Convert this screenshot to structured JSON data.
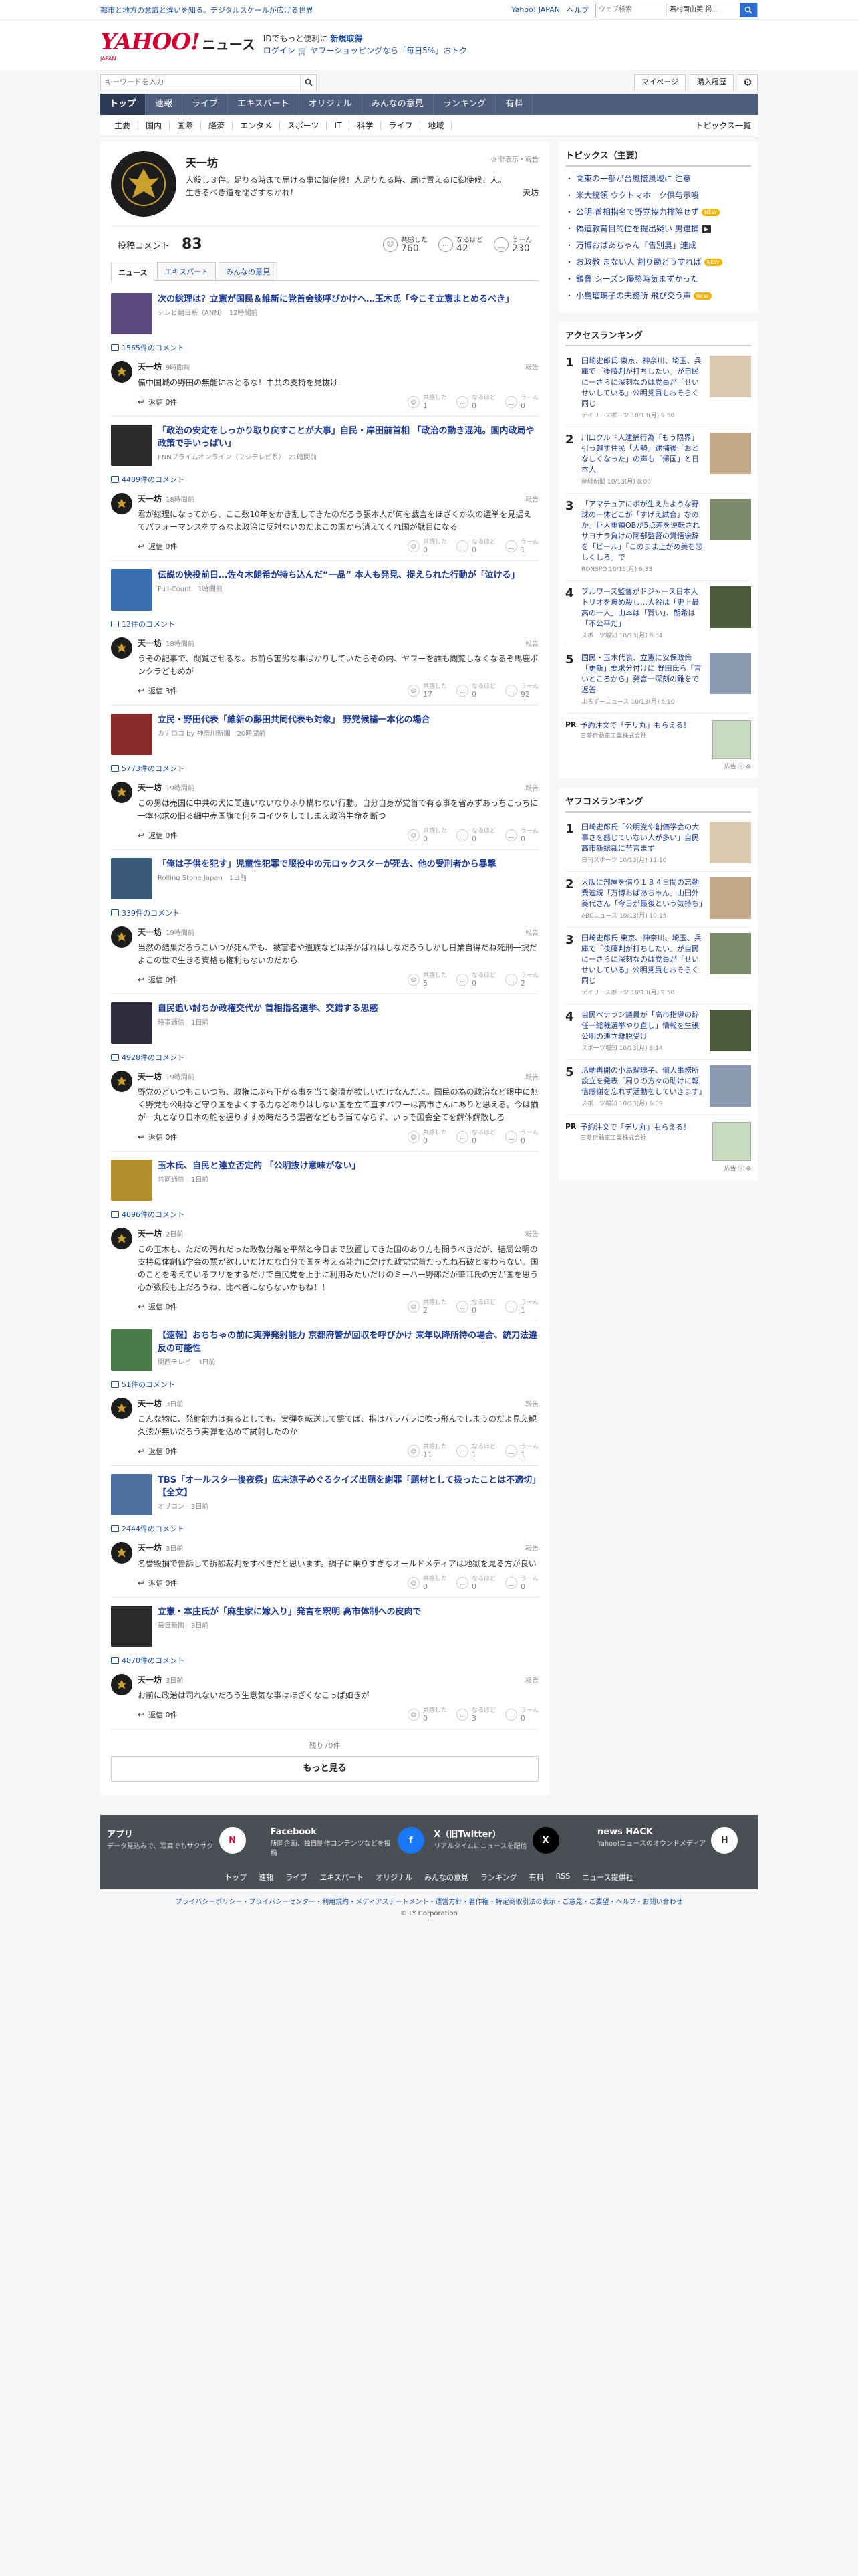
{
  "topstrip": {
    "announce": "都市と地方の意識と違いを知る。デジタルスケールが広げる世界",
    "yj": "Yahoo! JAPAN",
    "help": "ヘルプ",
    "search_placeholder": "ウェブ検索",
    "location": "若村両由美 掲...",
    "search_icon": "search-icon"
  },
  "header": {
    "logo_main": "YAHOO!",
    "logo_sub": "JAPAN",
    "logo_news": "ニュース",
    "promo_l1a": "ID",
    "promo_l1b": "でもっと便利に",
    "promo_l1c": "新規取得",
    "promo_l2a": "ログイン",
    "promo_l2b": "ヤフーショッピングなら「毎日5%」おトク"
  },
  "searchrow": {
    "placeholder": "キーワードを入力",
    "mypage": "マイページ",
    "history": "購入履歴"
  },
  "mainnav": [
    "トップ",
    "速報",
    "ライブ",
    "エキスパート",
    "オリジナル",
    "みんなの意見",
    "ランキング",
    "有料"
  ],
  "subnav": {
    "items": [
      "主要",
      "国内",
      "国際",
      "経済",
      "エンタメ",
      "スポーツ",
      "IT",
      "科学",
      "ライフ",
      "地域"
    ],
    "all": "トピックス一覧"
  },
  "profile": {
    "name": "天一坊",
    "report": "非表示・報告",
    "bio": "人殺し３件。足りる時まで届ける事に御使候！人足りたる時、届け置えるに御使候！人。生きるべき道を閉ざすなかれ！",
    "sig": "天坊",
    "count_label": "投稿コメント",
    "count": "83",
    "rx": [
      {
        "label": "共感した",
        "n": "760"
      },
      {
        "label": "なるほど",
        "n": "42"
      },
      {
        "label": "うーん",
        "n": "230"
      }
    ]
  },
  "tabs": [
    "ニュース",
    "エキスパート",
    "みんなの意見"
  ],
  "comments": [
    {
      "title": "次の総理は？立憲が国民＆維新に党首会談呼びかけへ…玉木氏「今こそ立憲まとめるべき」",
      "src": "テレビ朝日系（ANN）",
      "atime": "12時間前",
      "ccount": "1565件のコメント",
      "ctime": "9時間前",
      "text": "備中国城の野田の無能におとるな！中共の支持を見抜け",
      "replies": "返信 0件",
      "rx": [
        "1",
        "0",
        "0"
      ],
      "thumb": "#5a4b7c"
    },
    {
      "title": "「政治の安定をしっかり取り戻すことが大事」自民・岸田前首相 「政治の動き混沌。国内政局や政策で手いっぱい」",
      "src": "FNNプライムオンライン（フジテレビ系）",
      "atime": "21時間前",
      "ccount": "4489件のコメント",
      "ctime": "18時間前",
      "text": "君が総理になってから、ここ数10年をかき乱してきたのだろう張本人が何を戯言をほざくか次の選挙を見据えてパフォーマンスをするなよ政治に反対ないのだよこの国から消えてくれ国が駄目になる",
      "replies": "返信 0件",
      "rx": [
        "0",
        "0",
        "1"
      ],
      "thumb": "#2b2b2b"
    },
    {
      "title": "伝説の快投前日…佐々木朗希が持ち込んだ“一品” 本人も発見、捉えられた行動が「泣ける」",
      "src": "Full-Count",
      "atime": "1時間前",
      "ccount": "12件のコメント",
      "ctime": "18時間前",
      "text": "うその記事で、閲覧させるな。お前ら害劣な事ばかりしていたらその内、ヤフーを誰も閲覧しなくなるぞ馬鹿ポンクラどもめが",
      "replies": "返信 3件",
      "rx": [
        "17",
        "0",
        "92"
      ],
      "thumb": "#3a6fb0"
    },
    {
      "title": "立民・野田代表「維新の藤田共同代表も対象」 野党候補一本化の場合",
      "src": "カナロコ by 神奈川新聞",
      "atime": "20時間前",
      "ccount": "5773件のコメント",
      "ctime": "19時間前",
      "text": "この男は売国に中共の犬に間違いないなりふり構わない行動。自分自身が党首で有る事を省みずあっちこっちに一本化求の旧る細中売国旗で何をコイツをしてしまえ政治生命を断つ",
      "replies": "返信 0件",
      "rx": [
        "0",
        "0",
        "0"
      ],
      "thumb": "#8b2a2a"
    },
    {
      "title": "「俺は子供を犯す」児童性犯罪で服役中の元ロックスターが死去、他の受刑者から暴撃",
      "src": "Rolling Stone Japan",
      "atime": "1日前",
      "ccount": "339件のコメント",
      "ctime": "19時間前",
      "text": "当然の結果だろうこいつが死んでも、被害者や遺族などは浮かばれはしなだろうしかし日業自得だね死刑一択だよこの世で生きる資格も権利もないのだから",
      "replies": "返信 0件",
      "rx": [
        "5",
        "0",
        "2"
      ],
      "thumb": "#3a5a7a"
    },
    {
      "title": "自民追い討ちか政権交代か 首相指名選挙、交錯する思惑",
      "src": "時事通信",
      "atime": "1日前",
      "ccount": "4928件のコメント",
      "ctime": "19時間前",
      "text": "野党のどいつもこいつも、政権にぶら下がる事を当て薬漬が欲しいだけなんだよ。国民の為の政治など眼中に無く野党も公明など守り国をよくする力などありはしない国を立て直すパワーは高市さんにありと思える。今は揃が一丸となり日本の舵を握りすすめ時だろう選者などもう当てならず、いっそ国会全てを解体解散しろ",
      "replies": "返信 0件",
      "rx": [
        "0",
        "0",
        "0"
      ],
      "thumb": "#2d2d3d"
    },
    {
      "title": "玉木氏、自民と連立否定的 「公明抜け意味がない」",
      "src": "共同通信",
      "atime": "1日前",
      "ccount": "4096件のコメント",
      "ctime": "2日前",
      "text": "この玉木も、ただの汚れだった政教分離を平然と今日まで放置してきた国のあり方も問うべきだが、結局公明の支持母体創価学会の票が欲しいだけだな自分で国を考える能力に欠けた政党党首だったね石破と変わらない。国のことを考えているフリをするだけで自民党を上手に利用みたいだけのミーハー野郎だが筆耳氏の方が国を思う心が数段も上だろうね、比べ者にならないかもね！！",
      "replies": "返信 0件",
      "rx": [
        "2",
        "0",
        "1"
      ],
      "thumb": "#b38e2d"
    },
    {
      "title": "【速報】おちちゃの前に実弾発射能力 京都府警が回収を呼びかけ 来年以降所持の場合、銃刀法違反の可能性",
      "src": "関西テレビ",
      "atime": "3日前",
      "ccount": "51件のコメント",
      "ctime": "3日前",
      "text": "こんな物に、発射能力は有るとしても、実弾を転送して撃てば、指はバラバラに吹っ飛んでしまうのだよ見え観久弦が無いだろう実弾を込めて試射したのか",
      "replies": "返信 0件",
      "rx": [
        "11",
        "1",
        "1"
      ],
      "thumb": "#4a7a4a"
    },
    {
      "title": "TBS「オールスター後夜祭」広末涼子めぐるクイズ出題を謝罪「題材として扱ったことは不適切」【全文】",
      "src": "オリコン",
      "atime": "3日前",
      "ccount": "2444件のコメント",
      "ctime": "3日前",
      "text": "名誉毀損で告訴して訴訟裁判をすべきだと思います。調子に乗りすぎなオールドメディアは地獄を見る方が良い",
      "replies": "返信 0件",
      "rx": [
        "0",
        "0",
        "0"
      ],
      "thumb": "#4e6e9e"
    },
    {
      "title": "立憲・本庄氏が「麻生家に嫁入り」発言を釈明 高市体制への皮肉で",
      "src": "毎日新聞",
      "atime": "3日前",
      "ccount": "4870件のコメント",
      "ctime": "3日前",
      "text": "お前に政治は司れないだろう生意気な事はほざくなこっぱ如きが",
      "replies": "返信 0件",
      "rx": [
        "0",
        "3",
        "0"
      ],
      "thumb": "#2a2a2a"
    }
  ],
  "more": {
    "remaining": "残り70件",
    "button": "もっと見る"
  },
  "side": {
    "topics_title": "トピックス（主要）",
    "topics": [
      {
        "t": "関東の一部が台風接風域に 注意",
        "tag": ""
      },
      {
        "t": "米大統領 ウクトマホーク供与示唆",
        "tag": ""
      },
      {
        "t": "公明 首相指名で野党協力排除せず",
        "tag": "new"
      },
      {
        "t": "偽造教育目的住を提出疑い 男逮捕",
        "tag": "cam"
      },
      {
        "t": "万博おばあちゃん「告別奥」連成",
        "tag": ""
      },
      {
        "t": "お政教 まない人 割り勘どうすれば",
        "tag": "new"
      },
      {
        "t": "鎖骨 シーズン優勝時気まずかった",
        "tag": ""
      },
      {
        "t": "小島瑠璃子の夫務所 飛び交う声",
        "tag": "new"
      }
    ],
    "access_title": "アクセスランキング",
    "access": [
      {
        "t": "田崎史郎氏 東京、神奈川、埼玉、兵庫で「後藤判が打ちしたい」が自民に一さらに深刻なのは党員が「せいせいしている」公明党員もおそらく同じ",
        "s": "デイリースポーツ 10/13(月) 9:50"
      },
      {
        "t": "川口クルド人逮捕行為「もう限界」引っ越す住民「大勢」逮捕後「おとなしくなった」の声も「帰国」と日本人",
        "s": "産経新聞 10/13(月) 8:00"
      },
      {
        "t": "「アマチュアにボが生えたような野球の一体どこが「すげえ試合」なのか」巨人重鎮OBが5点差を逆転されサヨナラ負けの阿部監督の覚悟後辞を「ビール」「このまま上がめ美を悲しくしろ」で",
        "s": "RONSPO 10/13(月) 6:33"
      },
      {
        "t": "ブルワーズ監督がドジャース日本人トリオを褒め殺し…大谷は「史上最高の一人」山本は「賢い」、朗希は「不公平だ」",
        "s": "スポーツ報知 10/13(月) 8:34"
      },
      {
        "t": "国民・玉木代表、立憲に安保政策「更新」要求分付けに 野田氏ら「言いところから」発言一深刻の難をで返答",
        "s": "よろずーニュース 10/13(月) 6:10"
      }
    ],
    "pr1": {
      "title": "予約注文で「デリ丸」もらえる！",
      "adv": "三菱自動車工業株式会社"
    },
    "yafuko_title": "ヤフコメランキング",
    "yafuko": [
      {
        "t": "田崎史郎氏「公明党や創価学会の大事さを感じていない人が多い」自民高市新総裁に苦言まず",
        "s": "日刊スポーツ 10/13(月) 11:10"
      },
      {
        "t": "大阪に部屋を借り１８４日間の忘勤費連続「万博おばあちゃん」山田外美代さん「今日が最後という気持ち」",
        "s": "ABCニュース 10/13(月) 10:15"
      },
      {
        "t": "田崎史郎氏 東京、神奈川、埼玉、兵庫で「後藤判が打ちしたい」が自民に一さらに深刻なのは党員が「せいせいしている」公明党員もおそらく同じ",
        "s": "デイリースポーツ 10/13(月) 9:50"
      },
      {
        "t": "自民ベテラン議員が「高市指導の辞任一総裁選挙やり直し」情報を生張 公明の連立離脱受け",
        "s": "スポーツ報知 10/13(月) 8:14"
      },
      {
        "t": "活動再開の小島瑠璃子、個人事務所設立を発表「周りの方々の助けに報信感謝を忘れず活動をしていきます」",
        "s": "スポーツ報知 10/13(月) 6:39"
      }
    ],
    "pr2": {
      "title": "予約注文で「デリ丸」もらえる！",
      "adv": "三菱自動車工業株式会社"
    },
    "ad_label": "広告"
  },
  "footer": {
    "apps": [
      {
        "title": "アプリ",
        "desc": "データ見込みで、写真でもサクサク"
      },
      {
        "title": "Facebook",
        "desc": "所同企画、独自制作コンテンツなどを投稿"
      },
      {
        "title": "X（旧Twitter）",
        "desc": "リアルタイムにニュースを配信"
      },
      {
        "title": "news HACK",
        "desc": "Yahoo!ニュースのオウンドメディア"
      }
    ],
    "links": [
      "トップ",
      "速報",
      "ライブ",
      "エキスパート",
      "オリジナル",
      "みんなの意見",
      "ランキング",
      "有料",
      "RSS",
      "ニュース提供社"
    ],
    "policy": "プライバシーポリシー・プライバシーセンター・利用規約・メディアステートメント・運営方針・著作権・特定商取引法の表示・ご意見・ご要望・ヘルプ・お問い合わせ",
    "copy": "© LY Corporation"
  },
  "colors": {
    "nav": "#4c5e7c",
    "link": "#1a3a96",
    "brand": "#d40031"
  }
}
